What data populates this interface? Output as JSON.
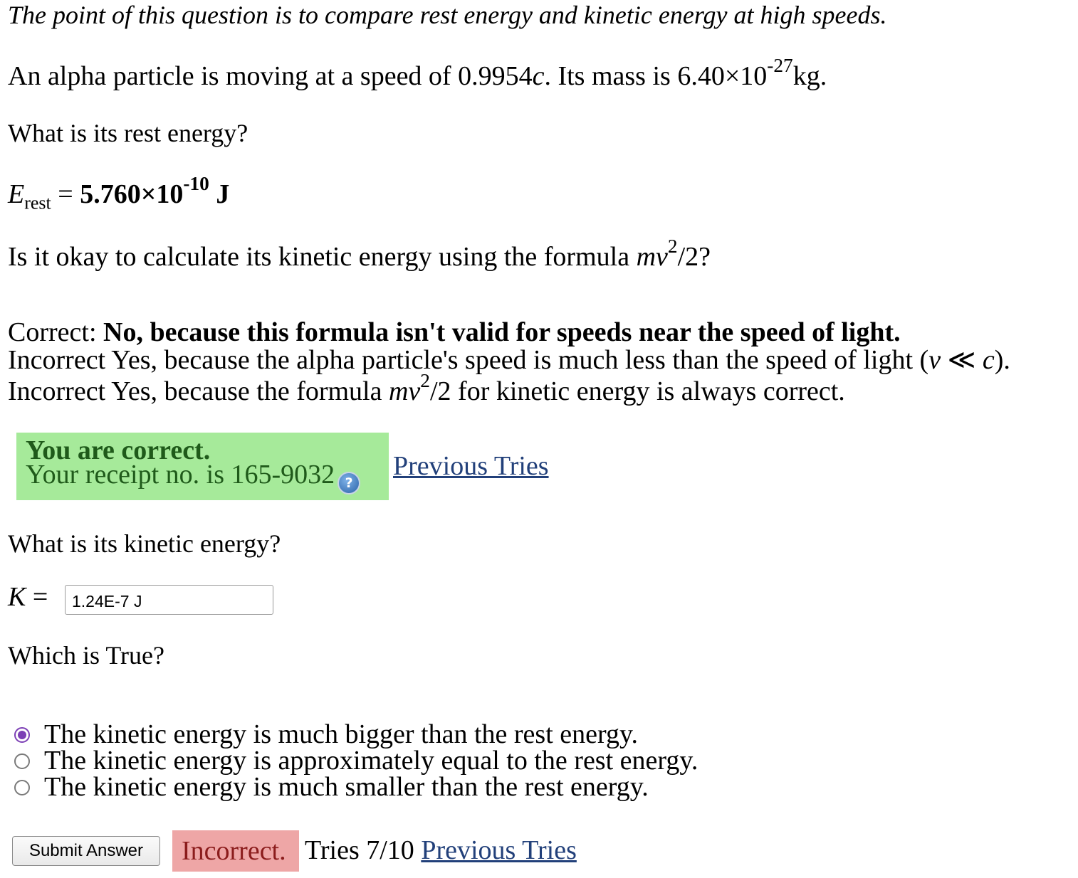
{
  "intro": "The point of this question is to compare rest energy and kinetic energy at high speeds.",
  "problem": {
    "part1": "An alpha particle is moving at a speed of 0.9954",
    "speed_symbol": "c",
    "part2": ". Its mass is 6.40×10",
    "mass_exponent": "-27",
    "part3": "kg."
  },
  "q1": {
    "question": "What is its rest energy?",
    "symbol": "E",
    "subscript": "rest",
    "equals": " = ",
    "answer_mantissa": "5.760×10",
    "answer_exponent": "-10",
    "answer_unit": " J"
  },
  "q2": {
    "question_pre": "Is it okay to calculate its kinetic energy using the formula ",
    "formula_mv": "mv",
    "formula_exp": "2",
    "formula_post": "/2?",
    "choice1_prefix": "Correct: ",
    "choice1_text": "No, because this formula isn't valid for speeds near the speed of light.",
    "choice2_prefix": "Incorrect ",
    "choice2_text": "Yes, because the alpha particle's speed is much less than the speed of light (",
    "choice2_v": "v",
    "choice2_ll": " ≪ ",
    "choice2_c": "c",
    "choice2_end": ").",
    "choice3_prefix": "Incorrect ",
    "choice3_pre": "Yes, because the formula ",
    "choice3_mv": "mv",
    "choice3_exp": "2",
    "choice3_post": "/2 for kinetic energy is always correct.",
    "feedback_title": "You are correct.",
    "receipt": "Your receipt no. is 165-9032",
    "help_glyph": "?",
    "previous_tries": "Previous Tries"
  },
  "q3": {
    "question": "What is its kinetic energy?",
    "symbol": "K",
    "equals": " = ",
    "input_value": "1.24E-7 J"
  },
  "q4": {
    "question": "Which is True?",
    "options": [
      "The kinetic energy is much bigger than the rest energy.",
      "The kinetic energy is approximately equal to the rest energy.",
      "The kinetic energy is much smaller than the rest energy."
    ],
    "selected_index": 0,
    "submit_label": "Submit Answer",
    "status": "Incorrect.",
    "tries": "Tries 7/10",
    "previous_tries": "Previous Tries"
  },
  "colors": {
    "correct_bg": "#a6ea9a",
    "correct_text": "#1f5a1a",
    "incorrect_bg": "#eea6a6",
    "incorrect_text": "#8b1c1c",
    "link": "#22407a",
    "radio_selected": "#7c3fb5"
  }
}
